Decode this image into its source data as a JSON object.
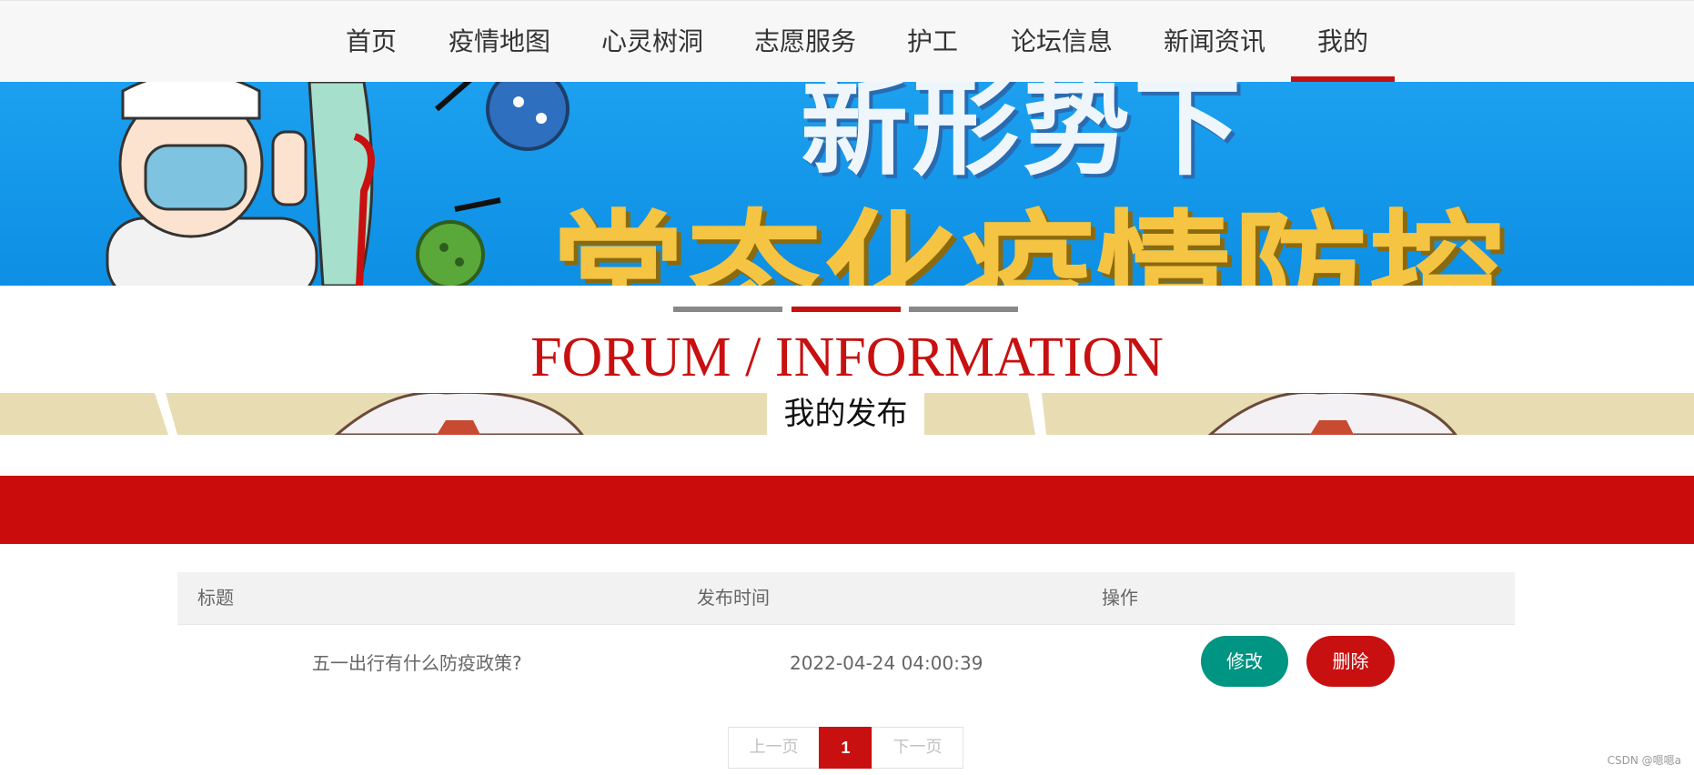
{
  "nav": {
    "items": [
      {
        "label": "首页"
      },
      {
        "label": "疫情地图"
      },
      {
        "label": "心灵树洞"
      },
      {
        "label": "志愿服务"
      },
      {
        "label": "护工"
      },
      {
        "label": "论坛信息"
      },
      {
        "label": "新闻资讯"
      },
      {
        "label": "我的"
      }
    ],
    "active_index": 7
  },
  "banner": {
    "line1": "新形势下",
    "line2": "常态化疫情防控"
  },
  "carousel": {
    "count": 3,
    "active_index": 1
  },
  "section": {
    "title": "FORUM / INFORMATION",
    "subtitle": "我的发布"
  },
  "table": {
    "headers": [
      "标题",
      "发布时间",
      "操作"
    ],
    "rows": [
      {
        "title": "五一出行有什么防疫政策?",
        "time": "2022-04-24 04:00:39",
        "edit_label": "修改",
        "delete_label": "删除"
      }
    ]
  },
  "pagination": {
    "prev_label": "上一页",
    "current_page": "1",
    "next_label": "下一页"
  },
  "watermark": "CSDN @嗯嗯a",
  "colors": {
    "accent_red": "#c81010",
    "edit_teal": "#009482",
    "nav_bg": "#f7f7f7"
  }
}
